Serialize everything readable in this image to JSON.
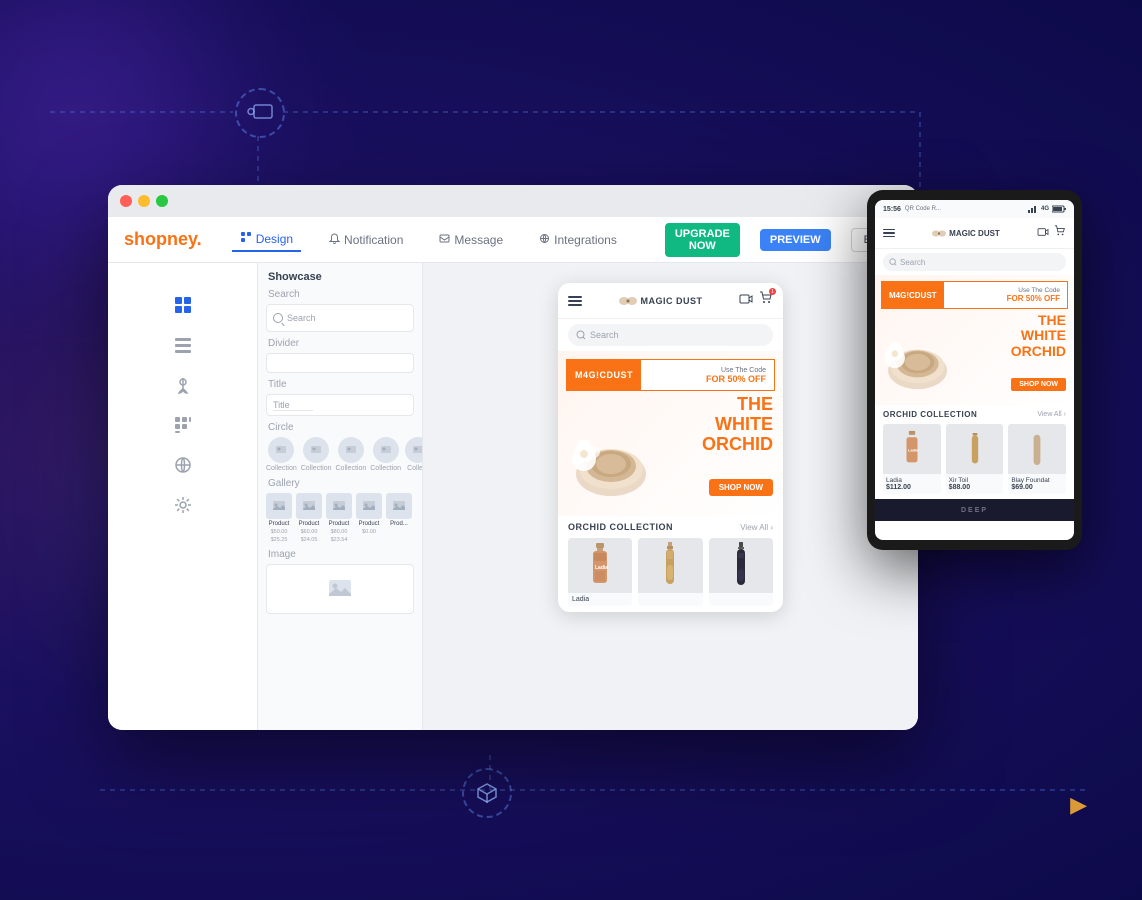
{
  "app": {
    "title": "Shopney",
    "logo_dot": ".",
    "tagline": "shopney."
  },
  "browser": {
    "traffic_buttons": [
      "red",
      "yellow",
      "green"
    ]
  },
  "nav": {
    "tabs": [
      {
        "label": "Design",
        "icon": "layout-icon",
        "active": true
      },
      {
        "label": "Notification",
        "icon": "bell-icon",
        "active": false
      },
      {
        "label": "Message",
        "icon": "message-icon",
        "active": false
      },
      {
        "label": "Integrations",
        "icon": "integrations-icon",
        "active": false
      }
    ],
    "upgrade_label": "UPGRADE NOW",
    "preview_label": "PREVIEW",
    "lang_label": "E"
  },
  "showcase": {
    "title": "Showcase",
    "sections": [
      {
        "label": "Search",
        "type": "search"
      },
      {
        "label": "Divider",
        "type": "divider"
      },
      {
        "label": "Title",
        "type": "title"
      },
      {
        "label": "Circle",
        "type": "circle"
      },
      {
        "label": "Gallery",
        "type": "gallery"
      },
      {
        "label": "Image",
        "type": "image"
      }
    ],
    "search_placeholder": "Search",
    "title_placeholder": "Title",
    "circle_items": [
      "Collection",
      "Collection",
      "Collection",
      "Collection",
      "Colle..."
    ],
    "gallery_items": [
      {
        "name": "Product",
        "price1": "$50.00",
        "price2": "$25.25"
      },
      {
        "name": "Product",
        "price1": "$60.00",
        "price2": "$24.05"
      },
      {
        "name": "Product",
        "price1": "$80.00",
        "price2": "$23.54"
      },
      {
        "name": "Product",
        "price1": "$0.00",
        "price2": ""
      },
      {
        "name": "Prod...",
        "price1": "",
        "price2": ""
      }
    ]
  },
  "phone_app": {
    "logo": "MAGIC DUST",
    "search_placeholder": "Search",
    "banner": {
      "promo_code": "M4G!CDUST",
      "promo_text1": "Use The Code",
      "promo_text2": "FOR 50% OFF",
      "title_line1": "THE",
      "title_line2": "WHITE",
      "title_line3": "ORCHID",
      "shop_btn": "SHOP NOW"
    },
    "collection": {
      "title": "ORCHID COLLECTION",
      "view_all": "View All ›",
      "products": [
        {
          "name": "Ladia",
          "price": ""
        },
        {
          "name": "",
          "price": ""
        },
        {
          "name": "",
          "price": ""
        }
      ]
    }
  },
  "tablet_app": {
    "status": {
      "time": "15:56",
      "qr_label": "QR Code R...",
      "signal": "4G ■■"
    },
    "logo": "MAGIC DUST",
    "search_placeholder": "Search",
    "banner": {
      "promo_code": "M4G!CDUST",
      "promo_text1": "Use The Code",
      "promo_text2": "FOR 50% OFF",
      "title_line1": "THE",
      "title_line2": "WHITE",
      "title_line3": "ORCHID",
      "shop_btn": "SHOP NOW"
    },
    "collection": {
      "title": "ORCHID COLLECTION",
      "view_all": "View All ›",
      "products": [
        {
          "name": "Ladia",
          "price": "$112.00"
        },
        {
          "name": "Xir Toil",
          "price": "$88.00"
        },
        {
          "name": "Blay Foundat",
          "price": "$69.00"
        }
      ]
    }
  },
  "decorations": {
    "dashed_lines": true,
    "rocket_icon": "🚀",
    "box_icon": "📦",
    "arrow_icon": "▶"
  }
}
